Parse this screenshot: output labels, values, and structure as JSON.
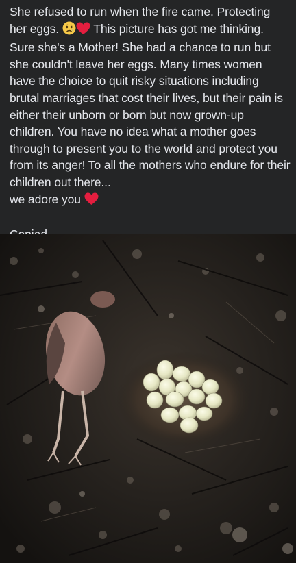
{
  "post": {
    "paragraph_1_line_1": "She refused to run when the fire came. Protecting",
    "paragraph_1_line_2a": "her eggs.",
    "paragraph_1_line_2b": "This picture has got me thinking.",
    "paragraph_1_rest": "Sure she's a Mother! She had a chance to run but she couldn't leave her eggs. Many times women have the choice to quit risky situations including brutal marriages that cost their lives, but their pain is either their unborn or born but now grown-up children. You have no idea what a mother goes through to present you to the world and protect you from its anger! To all the mothers who endure for their children out there...",
    "closing": "we adore you",
    "signature": "Copied.",
    "emojis": [
      "sad-face-emoji",
      "red-heart-emoji",
      "red-heart-emoji"
    ]
  },
  "photo": {
    "subject": "burnt-bird-and-eggs-photo"
  },
  "colors": {
    "background": "#242526",
    "text": "#e4e6eb",
    "heart": "#e41e3f"
  }
}
